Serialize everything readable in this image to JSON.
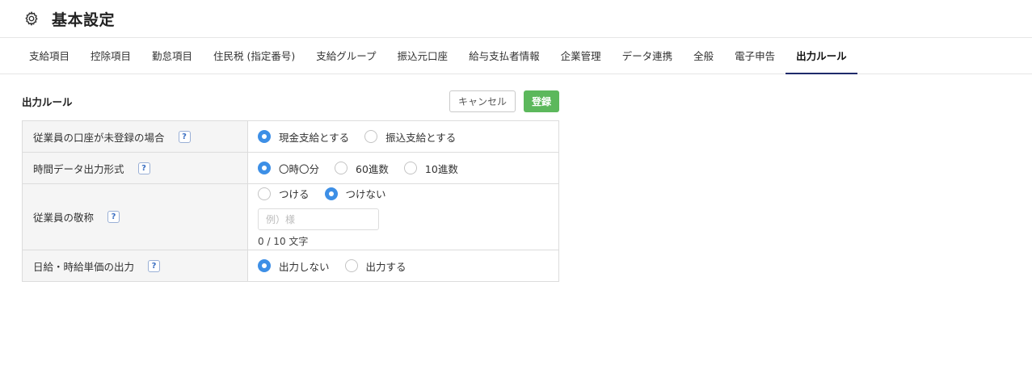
{
  "header": {
    "title": "基本設定",
    "icon": "gear-icon"
  },
  "tabs": [
    {
      "label": "支給項目",
      "active": false
    },
    {
      "label": "控除項目",
      "active": false
    },
    {
      "label": "勤怠項目",
      "active": false
    },
    {
      "label": "住民税 (指定番号)",
      "active": false
    },
    {
      "label": "支給グループ",
      "active": false
    },
    {
      "label": "振込元口座",
      "active": false
    },
    {
      "label": "給与支払者情報",
      "active": false
    },
    {
      "label": "企業管理",
      "active": false
    },
    {
      "label": "データ連携",
      "active": false
    },
    {
      "label": "全般",
      "active": false
    },
    {
      "label": "電子申告",
      "active": false
    },
    {
      "label": "出力ルール",
      "active": true
    }
  ],
  "section": {
    "title": "出力ルール",
    "cancel_label": "キャンセル",
    "register_label": "登録"
  },
  "help_mark": "?",
  "rows": {
    "account": {
      "label": "従業員の口座が未登録の場合",
      "options": [
        {
          "label": "現金支給とする",
          "selected": true
        },
        {
          "label": "振込支給とする",
          "selected": false
        }
      ]
    },
    "time_format": {
      "label": "時間データ出力形式",
      "options": [
        {
          "label": "〇時〇分",
          "selected": true
        },
        {
          "label": "60進数",
          "selected": false
        },
        {
          "label": "10進数",
          "selected": false
        }
      ]
    },
    "honorific": {
      "label": "従業員の敬称",
      "options": [
        {
          "label": "つける",
          "selected": false
        },
        {
          "label": "つけない",
          "selected": true
        }
      ],
      "input_value": "",
      "input_placeholder": "例）様",
      "char_count": "0 / 10 文字"
    },
    "unit_price": {
      "label": "日給・時給単価の出力",
      "options": [
        {
          "label": "出力しない",
          "selected": true
        },
        {
          "label": "出力する",
          "selected": false
        }
      ]
    }
  },
  "colors": {
    "accent_radio": "#3d8fe6",
    "register_button": "#5cb85c",
    "active_tab_underline": "#1f2a6b"
  }
}
